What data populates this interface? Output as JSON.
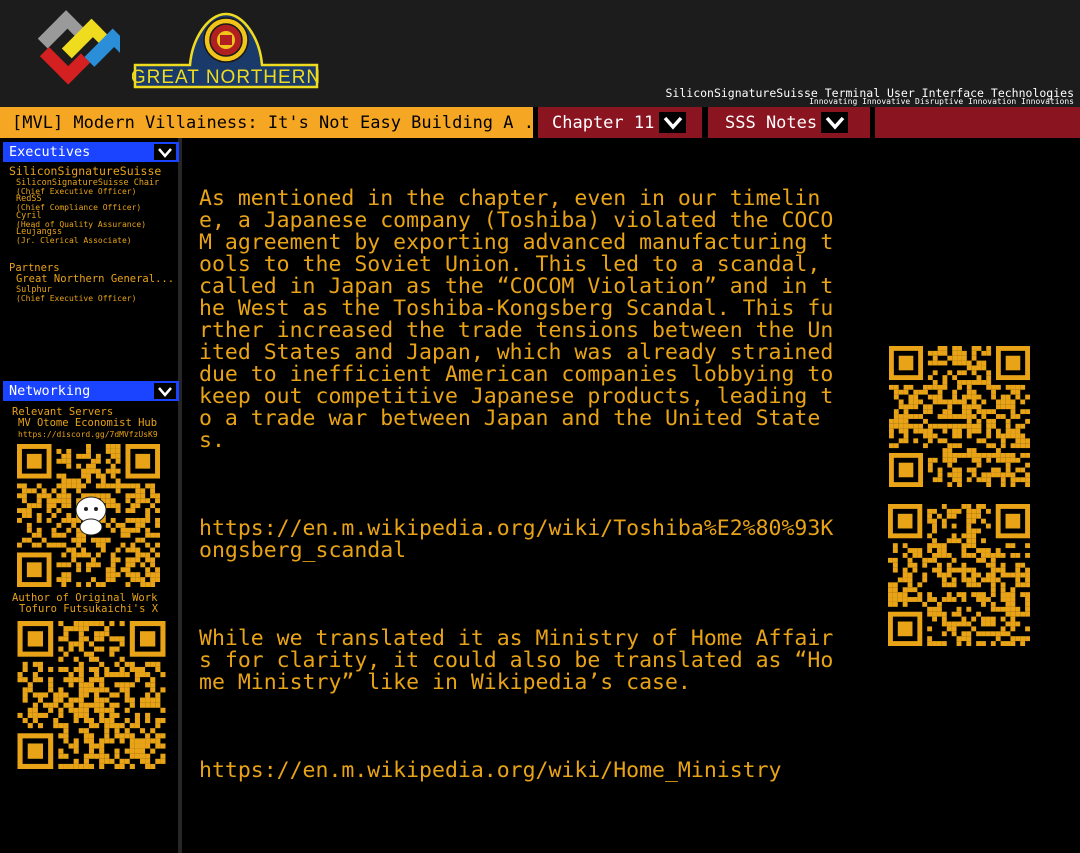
{
  "header": {
    "brand_title": "SiliconSignatureSuisse Terminal User Interface Technologies",
    "brand_tagline": "Innovating Innovative Disruptive Innovation Innovations",
    "partner_logo_text": "GREAT NORTHERN"
  },
  "tabs": {
    "story_title": "[MVL] Modern Villainess: It's Not Easy Building A ...",
    "chapter_label": "Chapter 11",
    "notes_label": "SSS Notes"
  },
  "sidebar": {
    "executives_header": "Executives",
    "org_name": "SiliconSignatureSuisse",
    "executives": [
      {
        "name": "SiliconSignatureSuisse Chair",
        "role": "(Chief Executive Officer)"
      },
      {
        "name": "RedSS",
        "role": "(Chief Compliance Officer)"
      },
      {
        "name": "Cyril",
        "role": "(Head of Quality Assurance)"
      },
      {
        "name": "Leujangss",
        "role": "(Jr. Clerical Associate)"
      }
    ],
    "partners_label": "Partners",
    "partner_org": "Great Northern General...",
    "partner_name": "Sulphur",
    "partner_role": "(Chief Executive Officer)",
    "networking_header": "Networking",
    "servers_label": "Relevant Servers",
    "server_name": "MV Otome Economist Hub",
    "server_url": "https://discord.gg/7dMVfzUsK9",
    "author_label": "Author of Original Work",
    "author_x": "Tofuro Futsukaichi's X"
  },
  "main": {
    "paragraphs": [
      "As mentioned in the chapter, even in our timeline, a Japanese company (Toshiba) violated the COCOM agreement by exporting advanced manufacturing tools to the Soviet Union. This led to a scandal, called in Japan as the “COCOM Violation” and in the West as the Toshiba-Kongsberg Scandal. This further increased the trade tensions between the United States and Japan, which was already strained due to inefficient American companies lobbying to keep out competitive Japanese products, leading to a trade war between Japan and the United States.",
      "https://en.m.wikipedia.org/wiki/Toshiba%E2%80%93Kongsberg_scandal",
      "While we translated it as Ministry of Home Affairs for clarity, it could also be translated as “Home Ministry” like in Wikipedia’s case.",
      "https://en.m.wikipedia.org/wiki/Home_Ministry"
    ]
  },
  "colors": {
    "accent_gold": "#e8a317",
    "tab_active": "#f5a623",
    "tab_inactive": "#8a1420",
    "sidebar_header": "#1a44ff",
    "header_bg": "#1c1c1c"
  },
  "icons": [
    "chevron-down-icon",
    "qr-code-icon",
    "sss-logo-icon",
    "great-northern-logo-icon"
  ]
}
